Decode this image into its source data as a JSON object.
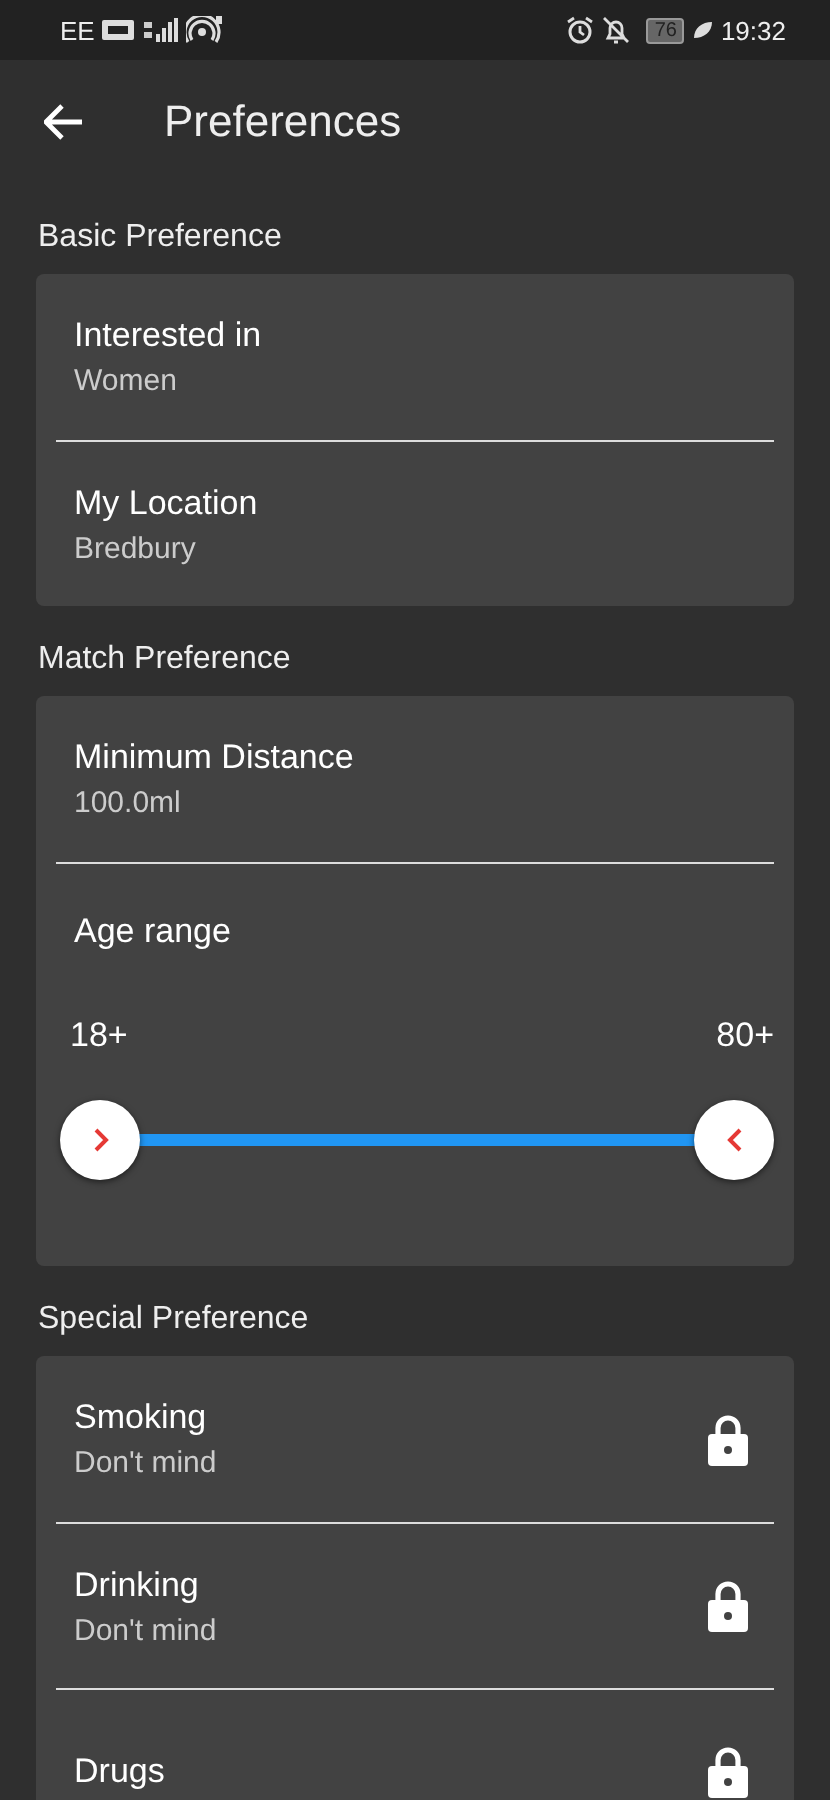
{
  "status_bar": {
    "carrier": "EE",
    "battery": "76",
    "time": "19:32"
  },
  "header": {
    "title": "Preferences"
  },
  "sections": [
    {
      "title": "Basic Preference",
      "items": [
        {
          "kind": "setting",
          "label": "Interested in",
          "value": "Women"
        },
        {
          "kind": "setting",
          "label": "My Location",
          "value": "Bredbury"
        }
      ]
    },
    {
      "title": "Match Preference",
      "items": [
        {
          "kind": "setting",
          "label": "Minimum Distance",
          "value": "100.0ml"
        },
        {
          "kind": "range",
          "label": "Age range",
          "min_label": "18+",
          "max_label": "80+",
          "start": {
            "level": 0
          },
          "end": {
            "level": 1
          }
        }
      ]
    },
    {
      "title": "Special Preference",
      "items": [
        {
          "kind": "setting",
          "label": "Smoking",
          "value": "Don't mind",
          "locked": true
        },
        {
          "kind": "setting",
          "label": "Drinking",
          "value": "Don't mind",
          "locked": true
        },
        {
          "kind": "setting",
          "label": "Drugs",
          "locked": true
        }
      ]
    }
  ]
}
